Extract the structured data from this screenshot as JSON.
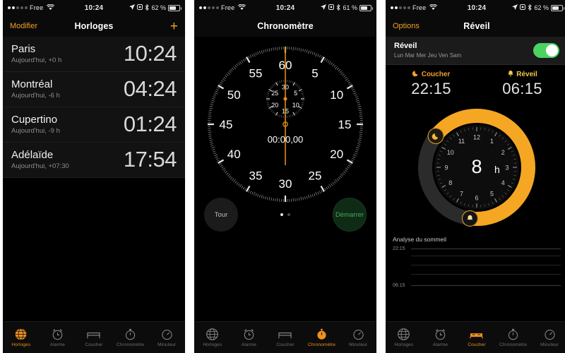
{
  "meta": {
    "accent_orange": "#f0a02a",
    "bg_black": "#000000",
    "panel_dark": "#121212",
    "green": "#4cd261"
  },
  "statusbar": {
    "carrier": "Free",
    "time": "10:24",
    "battery_1": "62 %",
    "battery_2": "61 %",
    "battery_3": "62 %",
    "wifi_icon": "wifi-icon",
    "location_icon": "location-arrow-icon",
    "rotation_icon": "rotation-lock-icon",
    "bluetooth_icon": "bluetooth-icon",
    "battery_icon": "battery-icon"
  },
  "panel1": {
    "nav": {
      "left": "Modifier",
      "title": "Horloges",
      "right": "+"
    },
    "clocks": [
      {
        "city": "Paris",
        "sub": "Aujourd'hui, +0 h",
        "time": "10:24"
      },
      {
        "city": "Montréal",
        "sub": "Aujourd'hui, -6 h",
        "time": "04:24"
      },
      {
        "city": "Cupertino",
        "sub": "Aujourd'hui, -9 h",
        "time": "01:24"
      },
      {
        "city": "Adélaïde",
        "sub": "Aujourd'hui, +07:30",
        "time": "17:54"
      }
    ]
  },
  "panel2": {
    "nav": {
      "title": "Chronomètre"
    },
    "stopwatch": {
      "display": "00:00,00",
      "outer_ticks": [
        "5",
        "10",
        "15",
        "20",
        "25",
        "30",
        "35",
        "40",
        "45",
        "50",
        "55",
        "60"
      ],
      "inner_ticks": [
        "5",
        "10",
        "15",
        "20",
        "25",
        "30"
      ],
      "lap_label": "Tour",
      "start_label": "Démarrer",
      "page_index": 1,
      "page_count": 2
    }
  },
  "panel3": {
    "nav": {
      "left": "Options",
      "title": "Réveil"
    },
    "toggle": {
      "title": "Réveil",
      "days": "Lun Mar Mer Jeu Ven Sam",
      "on": true
    },
    "times": {
      "bedtime_label": "Coucher",
      "bedtime_icon": "moon-icon",
      "bedtime_value": "22:15",
      "wake_label": "Réveil",
      "wake_icon": "bell-icon",
      "wake_value": "06:15"
    },
    "dial": {
      "center_value": "8",
      "center_unit": "h",
      "hours": [
        "1",
        "2",
        "3",
        "4",
        "5",
        "6",
        "7",
        "8",
        "9",
        "10",
        "11",
        "12"
      ],
      "bedtime_handle_icon": "moon-icon",
      "wake_handle_icon": "bell-icon"
    },
    "analysis": {
      "title": "Analyse du sommeil",
      "top_label": "22:15",
      "bottom_label": "06:15"
    }
  },
  "tabbar": {
    "items": [
      {
        "label": "Horloges",
        "icon": "globe-icon"
      },
      {
        "label": "Alarme",
        "icon": "alarm-clock-icon"
      },
      {
        "label": "Coucher",
        "icon": "bed-icon"
      },
      {
        "label": "Chronomètre",
        "icon": "stopwatch-icon"
      },
      {
        "label": "Minuteur",
        "icon": "timer-icon"
      }
    ],
    "active_panel1": 0,
    "active_panel2": 3,
    "active_panel3": 2
  }
}
